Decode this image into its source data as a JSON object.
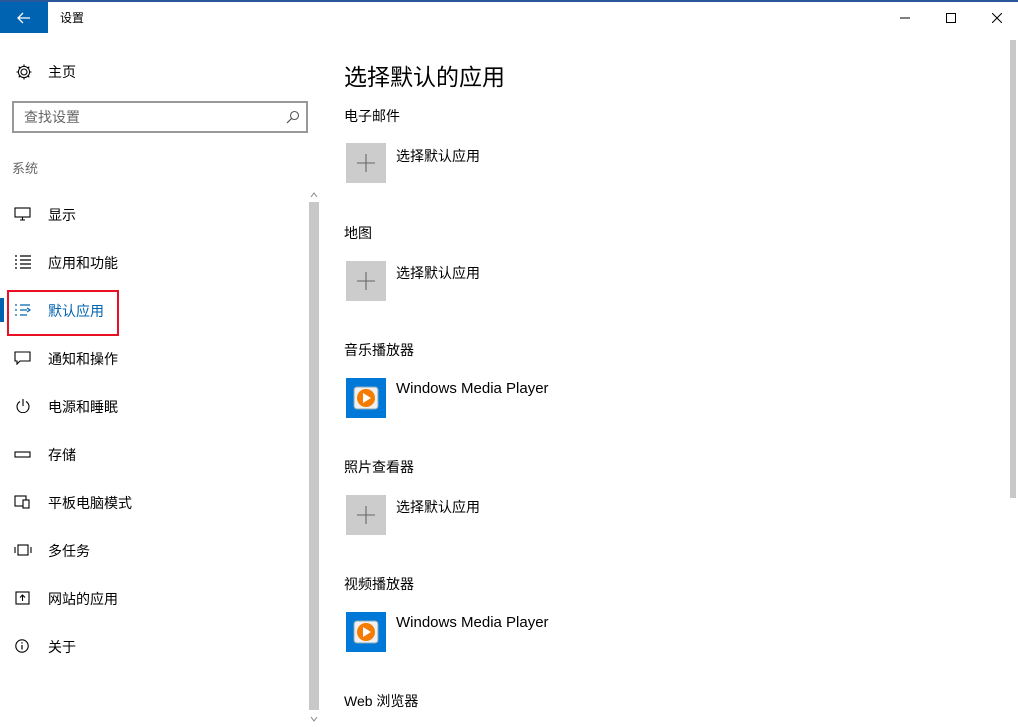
{
  "window": {
    "title": "设置",
    "accent": "#0063b1"
  },
  "sidebar": {
    "home_label": "主页",
    "search_placeholder": "查找设置",
    "section_label": "系统",
    "items": [
      {
        "label": "显示",
        "icon": "monitor-icon"
      },
      {
        "label": "应用和功能",
        "icon": "apps-list-icon"
      },
      {
        "label": "默认应用",
        "icon": "default-apps-icon",
        "selected": true
      },
      {
        "label": "通知和操作",
        "icon": "notification-icon"
      },
      {
        "label": "电源和睡眠",
        "icon": "power-icon"
      },
      {
        "label": "存储",
        "icon": "storage-icon"
      },
      {
        "label": "平板电脑模式",
        "icon": "tablet-mode-icon"
      },
      {
        "label": "多任务",
        "icon": "multitasking-icon"
      },
      {
        "label": "网站的应用",
        "icon": "web-apps-icon"
      },
      {
        "label": "关于",
        "icon": "info-icon"
      }
    ]
  },
  "main": {
    "title": "选择默认的应用",
    "categories": [
      {
        "label": "电子邮件",
        "app": "选择默认应用",
        "icon": "plus-icon"
      },
      {
        "label": "地图",
        "app": "选择默认应用",
        "icon": "plus-icon"
      },
      {
        "label": "音乐播放器",
        "app": "Windows Media Player",
        "icon": "windows-media-player-icon"
      },
      {
        "label": "照片查看器",
        "app": "选择默认应用",
        "icon": "plus-icon"
      },
      {
        "label": "视频播放器",
        "app": "Windows Media Player",
        "icon": "windows-media-player-icon"
      },
      {
        "label": "Web 浏览器"
      }
    ]
  }
}
